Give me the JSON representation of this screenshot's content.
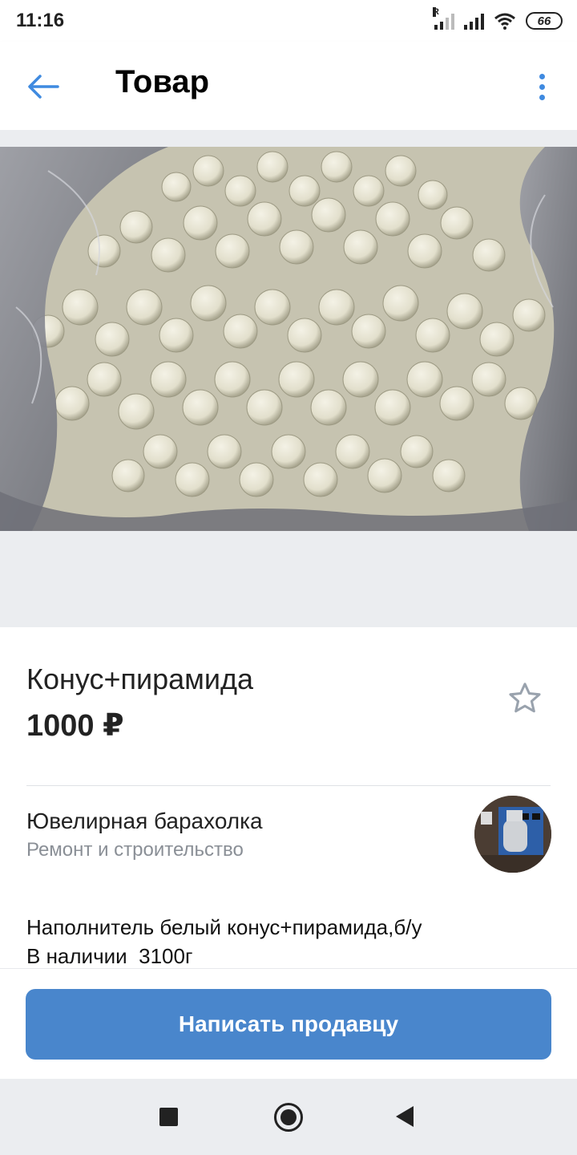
{
  "status_bar": {
    "time": "11:16",
    "roaming_label": "R",
    "battery": "66"
  },
  "app_bar": {
    "back_icon": "arrow-left-icon",
    "title": "Товар",
    "menu_icon": "more-vertical-icon",
    "accent_color": "#3f8ae0"
  },
  "gallery": {
    "image_alt": "white cone and pyramid media in plastic bag"
  },
  "product": {
    "title": "Конус+пирамида",
    "price": "1000 ₽",
    "favorite_icon": "star-outline-icon"
  },
  "seller": {
    "name": "Ювелирная барахолка",
    "category": "Ремонт и строительство",
    "avatar_icon": "community-avatar"
  },
  "description": {
    "text": "Наполнитель белый конус+пирамида,б/у\nВ наличии  3100г"
  },
  "action": {
    "write_seller_label": "Написать продавцу",
    "button_color": "#4986cc"
  },
  "nav_bar": {
    "recent_icon": "square-icon",
    "home_icon": "circle-icon",
    "back_icon": "triangle-back-icon"
  }
}
